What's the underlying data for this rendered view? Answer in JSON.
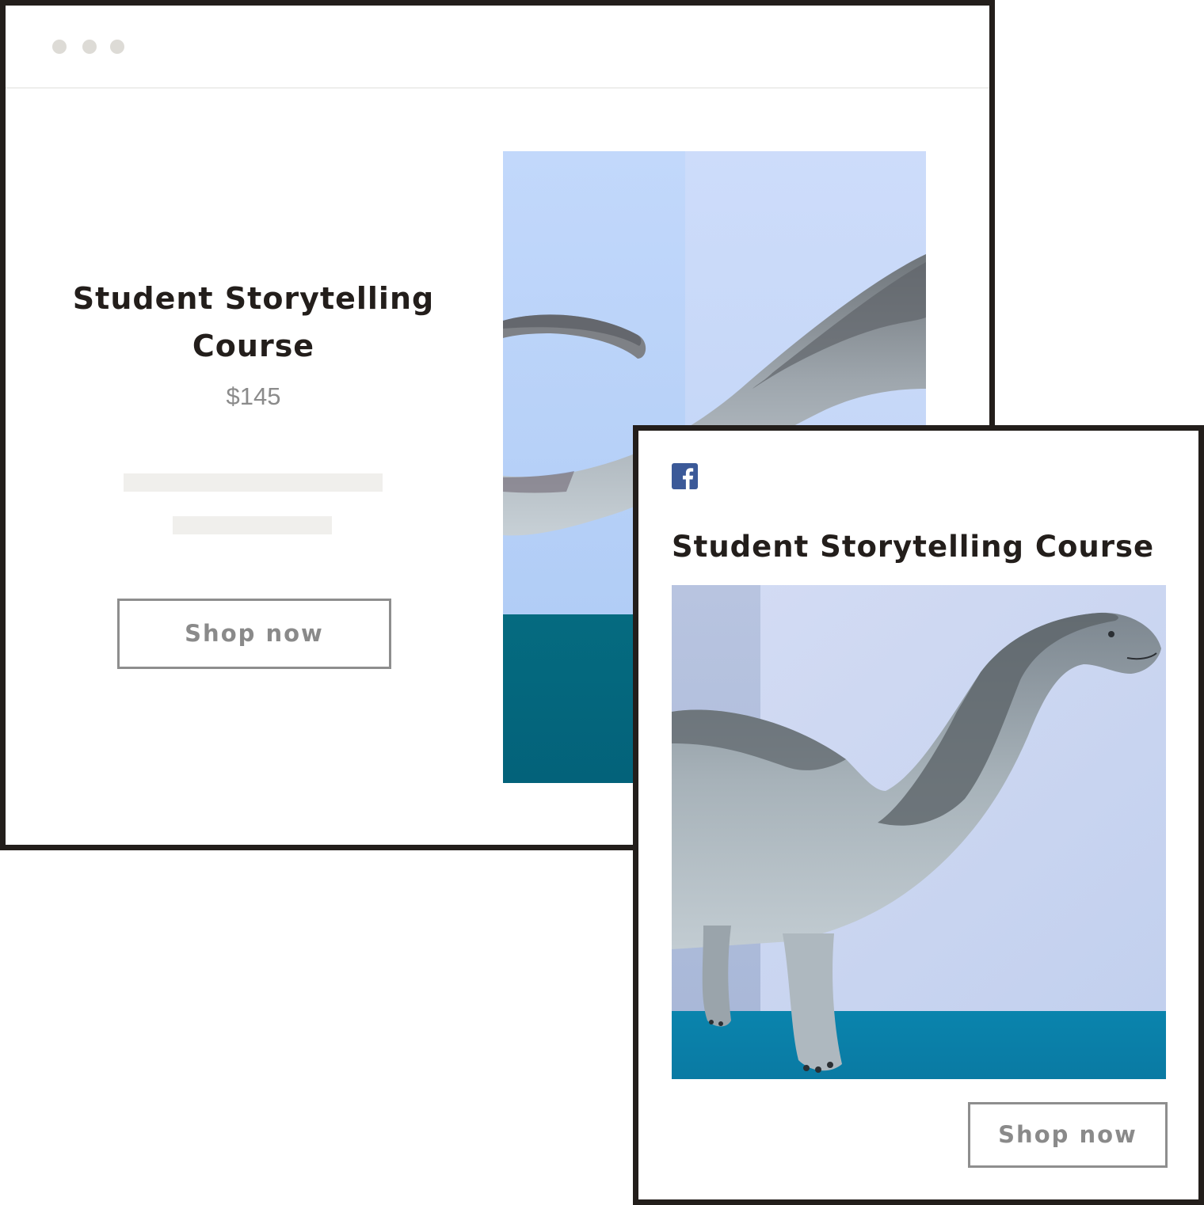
{
  "website": {
    "product_title": "Student Storytelling Course",
    "price": "$145",
    "shop_button_label": "Shop now",
    "hero_image_alt": "toy dinosaur neck and tail against blue background"
  },
  "facebook_ad": {
    "platform_icon": "facebook-icon",
    "title": "Student Storytelling Course",
    "image_alt": "toy brontosaurus dinosaur on teal floor with light blue wall",
    "shop_button_label": "Shop now"
  },
  "colors": {
    "frame_border": "#231e1b",
    "title_text": "#231e1b",
    "price_text": "#8b8b8b",
    "button_border": "#8e8e8e",
    "placeholder": "#f0efec",
    "window_dots": "#dddbd6",
    "facebook_blue": "#3b5998",
    "photo_wall_blue": "#c6dafa",
    "photo_floor_teal": "#046b80"
  }
}
